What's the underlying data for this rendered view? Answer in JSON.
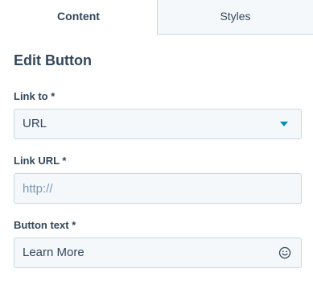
{
  "tabs": [
    {
      "label": "Content",
      "active": true
    },
    {
      "label": "Styles",
      "active": false
    }
  ],
  "panel": {
    "title": "Edit Button"
  },
  "fields": {
    "link_to": {
      "label": "Link to *",
      "selected": "URL",
      "icon": "chevron-down-icon"
    },
    "link_url": {
      "label": "Link URL *",
      "value": "",
      "placeholder": "http://"
    },
    "button_text": {
      "label": "Button text *",
      "value": "Learn More",
      "icon": "emoji-smiley-icon"
    }
  },
  "colors": {
    "text": "#33475b",
    "accent": "#0091ae",
    "border": "#cbd6e2",
    "input_bg": "#f5f8fa",
    "placeholder": "#7c98b6"
  }
}
